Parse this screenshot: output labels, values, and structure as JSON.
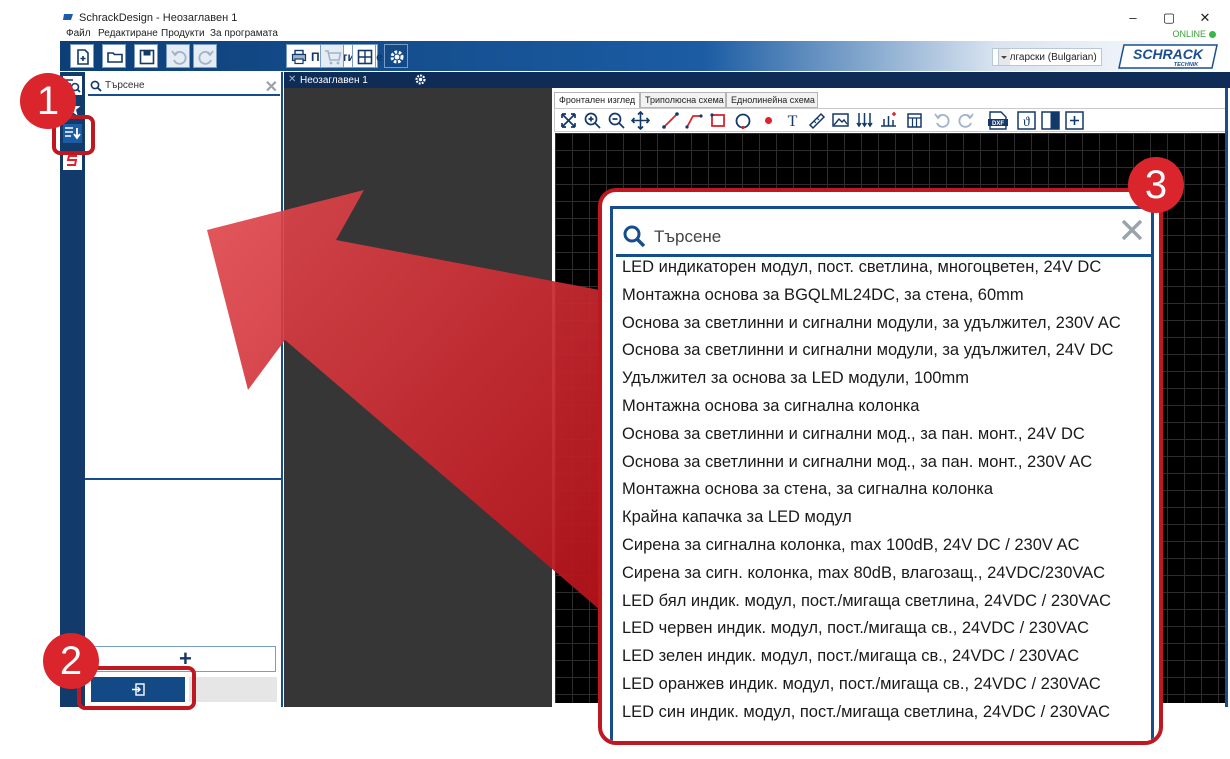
{
  "window": {
    "title": "SchrackDesign - Неозаглавен 1"
  },
  "menu": {
    "items": [
      "Файл",
      "Редактиране",
      "Продукти",
      "За програмата"
    ]
  },
  "status": {
    "online": "ONLINE"
  },
  "toolbar": {
    "print_label": "Принтиране",
    "language": "български (Bulgarian)"
  },
  "logo": {
    "line1": "SCHRACK",
    "line2": "TECHNIK"
  },
  "left_panel": {
    "search_placeholder": "Търсене",
    "add_symbol": "+"
  },
  "document": {
    "tab_name": "Неозаглавен 1"
  },
  "view_tabs": [
    "Фронтален изглед",
    "Триполюсна схема",
    "Еднолинейна схема"
  ],
  "zoom": {
    "search_placeholder": "Търсене",
    "items": [
      "LED индикаторен модул, пост. светлина, многоцветен, 24V DC",
      "Монтажна основа за BGQLML24DC, за стена, 60mm",
      "Основа за светлинни и сигнални модули, за удължител, 230V AC",
      "Основа за светлинни и сигнални модули, за удължител, 24V DC",
      "Удължител за основа за LED модули, 100mm",
      "Монтажна основа за сигнална колонка",
      "Основа за светлинни и сигнални мод., за пан. монт., 24V DC",
      "Основа за светлинни и сигнални мод., за пан. монт., 230V AC",
      "Монтажна основа за стена, за сигнална колонка",
      "Крайна капачка за LED модул",
      "Сирена за сигнална колонка, max 100dB, 24V DC / 230V AC",
      "Сирена за сигн. колонка, max 80dB, влагозащ., 24VDC/230VAC",
      "LED бял индик. модул, пост./мигаща светлина, 24VDC / 230VAC",
      "LED червен индик. модул, пост./мигаща св., 24VDC / 230VAC",
      "LED зелен индик. модул, пост./мигаща св., 24VDC / 230VAC",
      "LED оранжев индик. модул, пост./мигаща св., 24VDC / 230VAC",
      "LED син индик. модул, пост./мигаща светлина, 24VDC / 230VAC"
    ]
  },
  "badges": [
    "1",
    "2",
    "3"
  ],
  "colors": {
    "brand_blue": "#164e8c",
    "highlight_red": "#c01820",
    "badge_red": "#d9252b"
  }
}
